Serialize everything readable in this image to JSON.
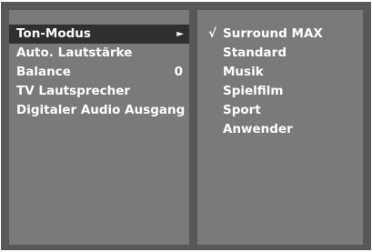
{
  "menu": {
    "items": [
      {
        "label": "Ton-Modus",
        "value": "",
        "has_submenu": true,
        "selected": true
      },
      {
        "label": "Auto. Lautstärke",
        "value": "",
        "has_submenu": false,
        "selected": false
      },
      {
        "label": "Balance",
        "value": "0",
        "has_submenu": false,
        "selected": false
      },
      {
        "label": "TV Lautsprecher",
        "value": "",
        "has_submenu": false,
        "selected": false
      },
      {
        "label": "Digitaler Audio Ausgang",
        "value": "",
        "has_submenu": false,
        "selected": false
      }
    ],
    "submenu_arrow_icon": "arrow-right-icon",
    "submenu_arrow_glyph": "►"
  },
  "submenu": {
    "check_glyph": "√",
    "options": [
      {
        "label": "Surround MAX",
        "checked": true
      },
      {
        "label": "Standard",
        "checked": false
      },
      {
        "label": "Musik",
        "checked": false
      },
      {
        "label": "Spielfilm",
        "checked": false
      },
      {
        "label": "Sport",
        "checked": false
      },
      {
        "label": "Anwender",
        "checked": false
      }
    ]
  },
  "colors": {
    "background": "#585858",
    "panel": "#7a7a7a",
    "highlight": "#2f2f2f",
    "text": "#ffffff"
  }
}
